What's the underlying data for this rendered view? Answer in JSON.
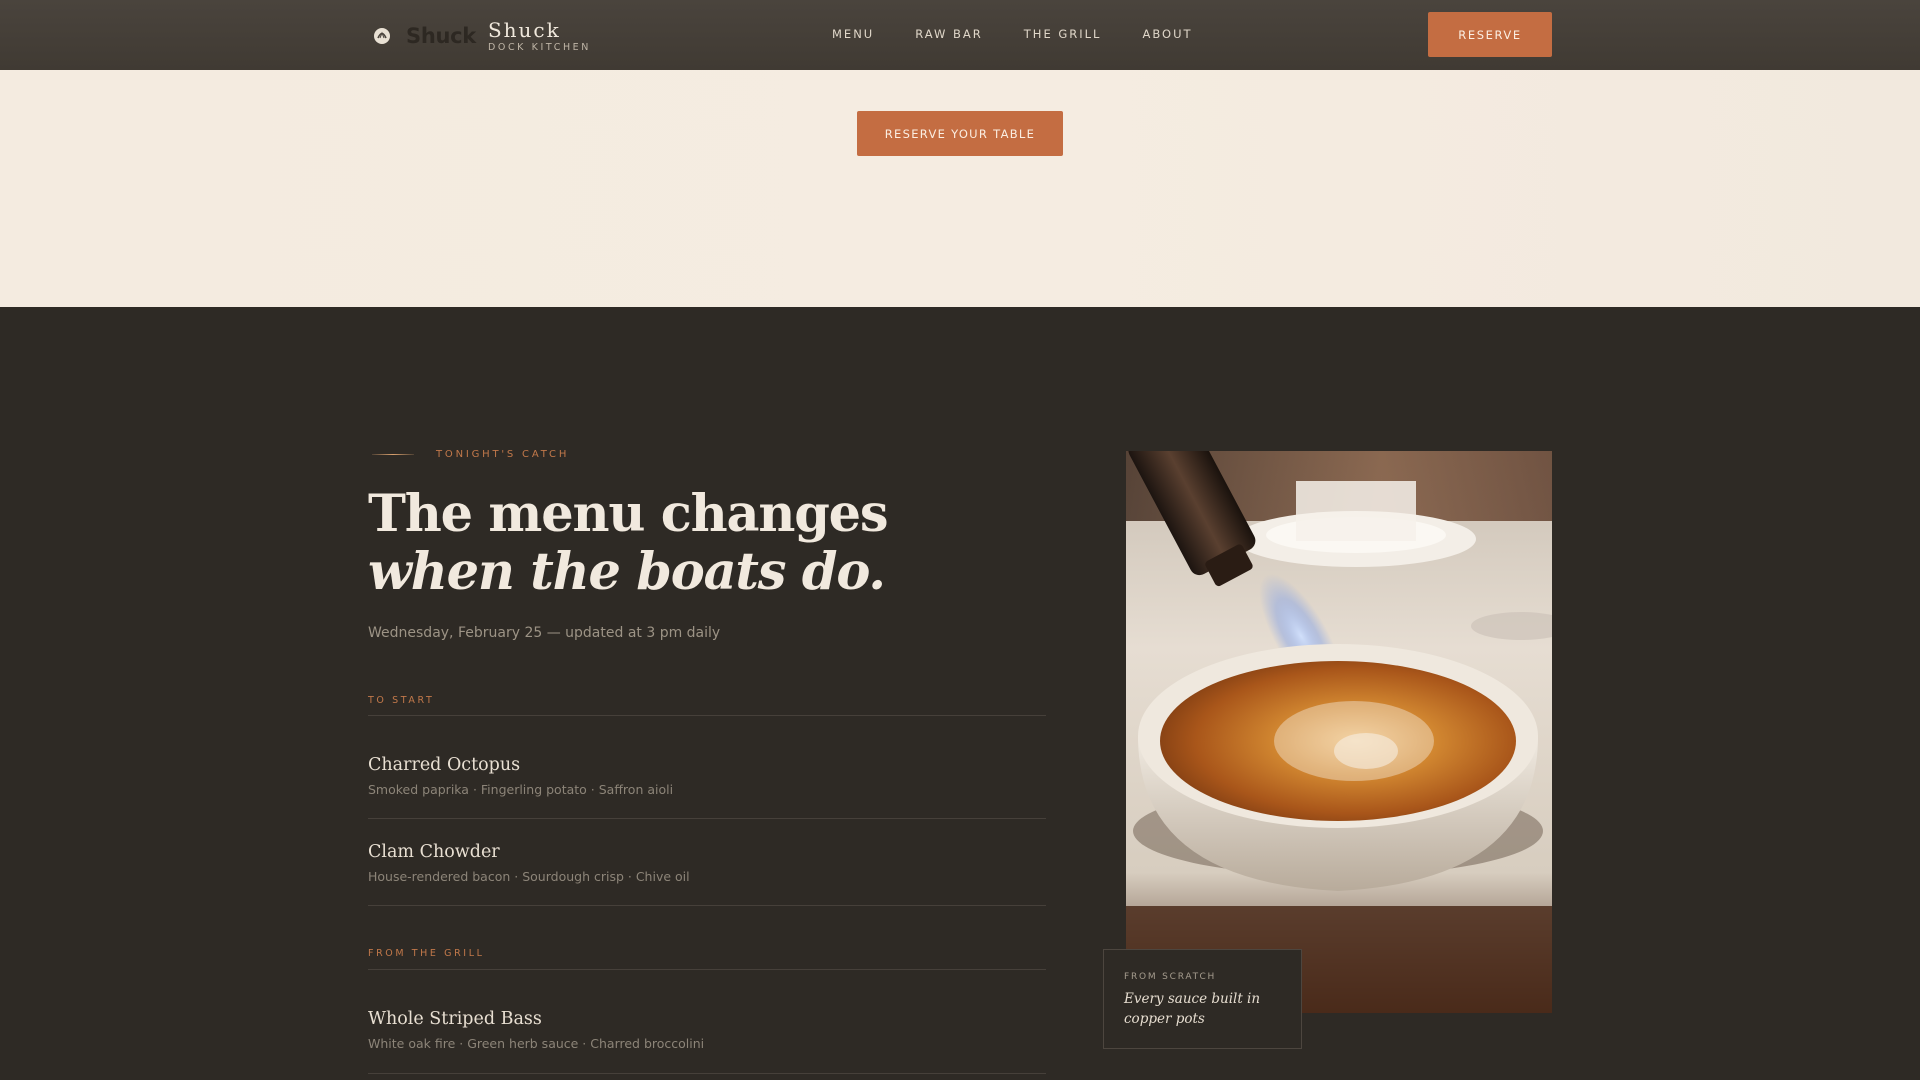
{
  "header": {
    "logo_text": "Shuck",
    "brand_name": "Shuck",
    "brand_sub": "DOCK KITCHEN",
    "nav": [
      "MENU",
      "RAW BAR",
      "THE GRILL",
      "ABOUT"
    ],
    "reserve_label": "RESERVE"
  },
  "hero": {
    "reserve_table_label": "RESERVE YOUR TABLE"
  },
  "menu": {
    "eyebrow": "TONIGHT'S CATCH",
    "headline_line1": "The menu changes",
    "headline_line2": "when the boats do.",
    "dateline": "Wednesday, February 25 — updated at 3 pm daily",
    "categories": [
      {
        "label": "TO START",
        "dishes": [
          {
            "name": "Charred Octopus",
            "desc": "Smoked paprika · Fingerling potato · Saffron aioli"
          },
          {
            "name": "Clam Chowder",
            "desc": "House-rendered bacon · Sourdough crisp · Chive oil"
          }
        ]
      },
      {
        "label": "FROM THE GRILL",
        "dishes": [
          {
            "name": "Whole Striped Bass",
            "desc": "White oak fire · Green herb sauce · Charred broccolini"
          }
        ]
      }
    ]
  },
  "feature": {
    "caption_eyebrow": "FROM SCRATCH",
    "caption_text": "Every sauce built in copper pots"
  },
  "colors": {
    "accent": "#c46d42",
    "header_bg": "#453f38",
    "cream": "#f4ebe0",
    "dark_bg": "#2e2a25"
  }
}
